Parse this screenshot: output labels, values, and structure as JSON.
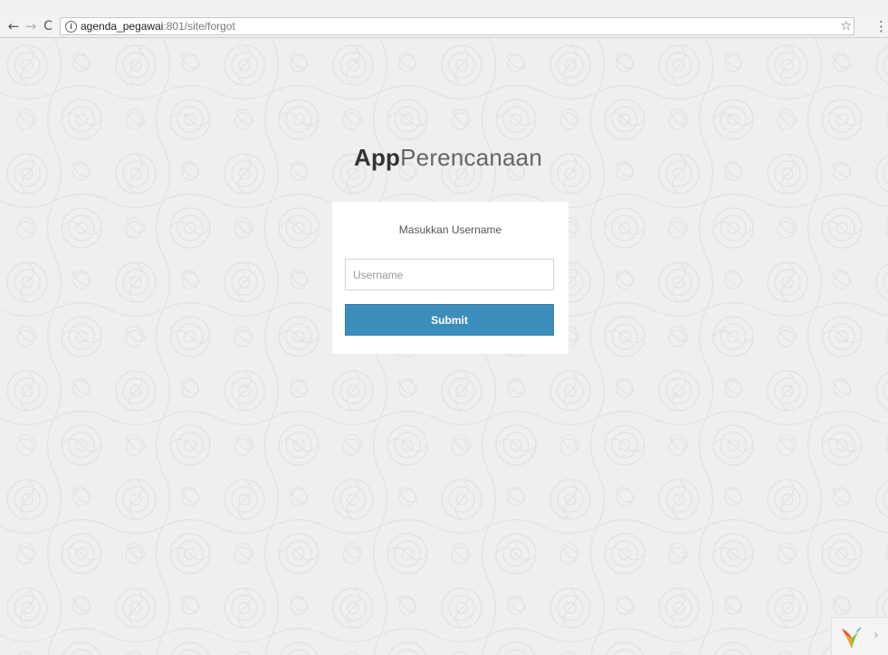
{
  "browser": {
    "url_host": "agenda_pegawai",
    "url_rest": ":801/site/forgot",
    "back_icon": "←",
    "forward_icon": "→",
    "reload_icon": "C",
    "info_icon": "i",
    "star_icon": "☆",
    "menu_icon": "⋮"
  },
  "app": {
    "title_bold": "App",
    "title_light": "Perencanaan"
  },
  "form": {
    "message": "Masukkan Username",
    "username_placeholder": "Username",
    "username_value": "",
    "submit_label": "Submit"
  },
  "widget": {
    "arrow": "›"
  },
  "colors": {
    "primary": "#3c8dbc",
    "background": "#efefef"
  }
}
